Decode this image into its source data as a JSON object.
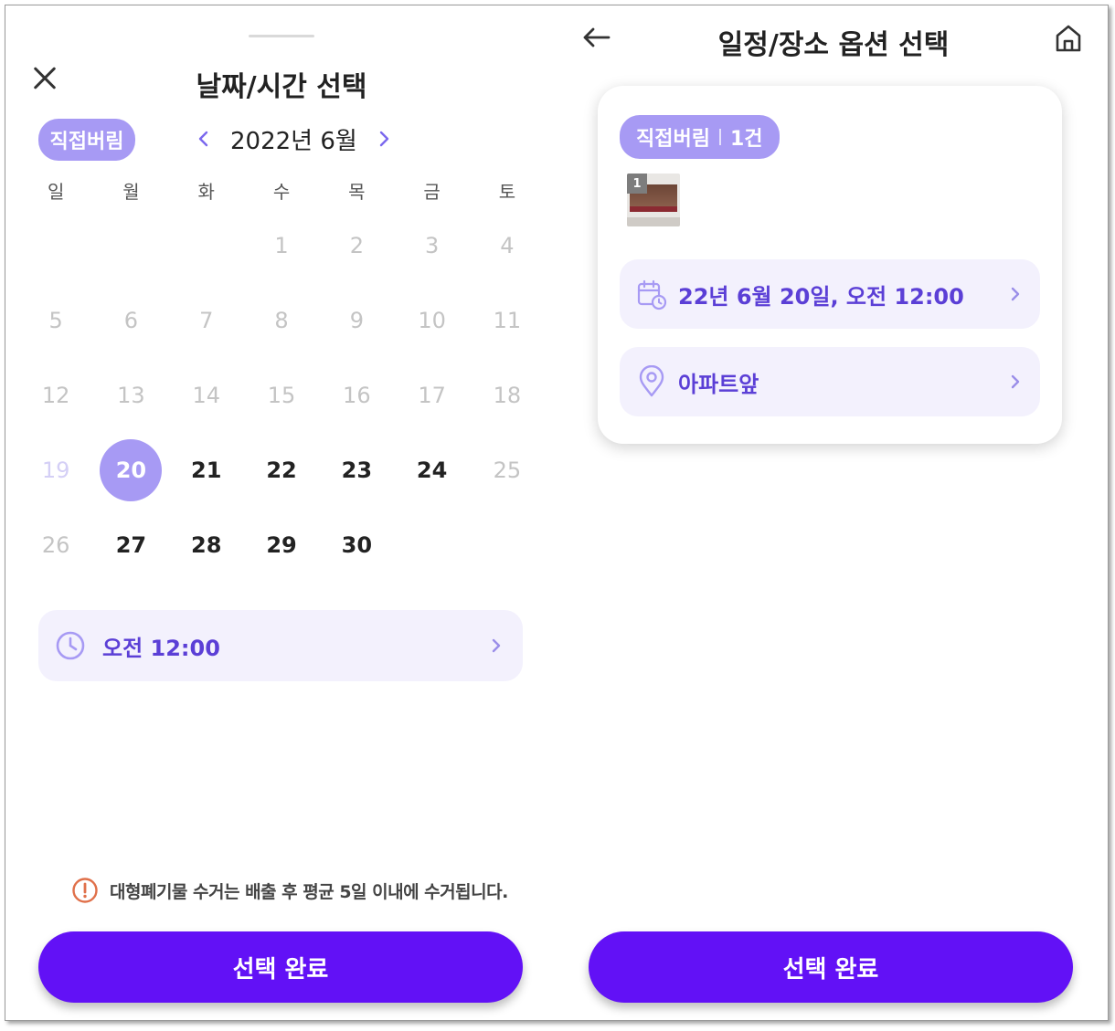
{
  "left": {
    "title": "날짜/시간 선택",
    "chip": "직접버림",
    "month": "2022년 6월",
    "weekdays": [
      "일",
      "월",
      "화",
      "수",
      "목",
      "금",
      "토"
    ],
    "days": [
      "",
      "",
      "",
      "1",
      "2",
      "3",
      "4",
      "5",
      "6",
      "7",
      "8",
      "9",
      "10",
      "11",
      "12",
      "13",
      "14",
      "15",
      "16",
      "17",
      "18",
      "19",
      "20",
      "21",
      "22",
      "23",
      "24",
      "25",
      "26",
      "27",
      "28",
      "29",
      "30",
      "",
      ""
    ],
    "selected_day": "20",
    "time": "오전 12:00",
    "notice": "대형폐기물 수거는 배출 후 평균 5일 이내에 수거됩니다.",
    "cta": "선택 완료"
  },
  "right": {
    "title": "일정/장소 옵션 선택",
    "chip_label": "직접버림",
    "chip_count": "1건",
    "thumb_number": "1",
    "date_time": "22년 6월 20일, 오전 12:00",
    "place": "아파트앞",
    "cta": "선택 완료"
  },
  "colors": {
    "accent": "#6211f6",
    "chip": "#a79af4",
    "row_bg": "#f3f1fd",
    "row_text": "#5b3fd6",
    "warning": "#e0704a"
  },
  "icons": [
    "close-icon",
    "chevron-left-icon",
    "chevron-right-icon",
    "clock-icon",
    "warning-icon",
    "arrow-left-icon",
    "home-icon",
    "calendar-clock-icon",
    "location-pin-icon"
  ]
}
